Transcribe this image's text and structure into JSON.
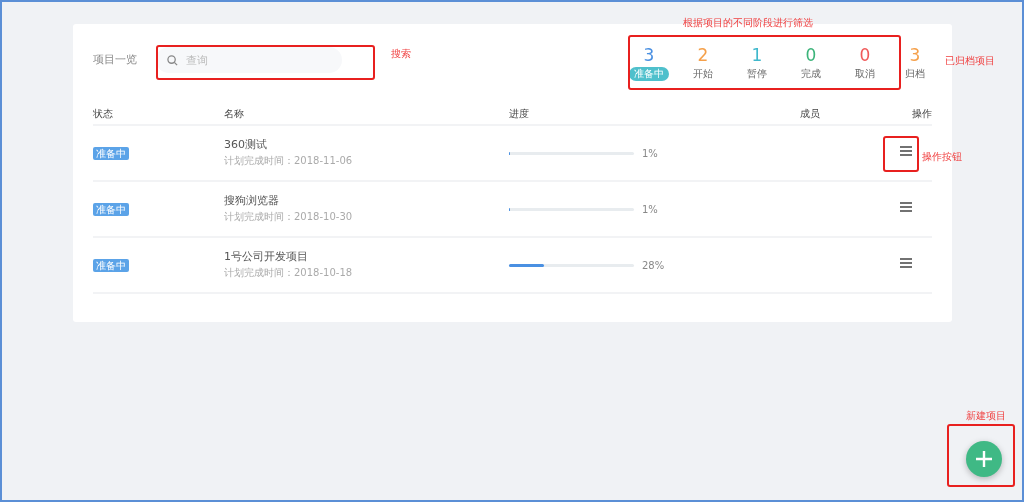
{
  "header": {
    "title": "项目一览",
    "search": {
      "placeholder": "查询"
    }
  },
  "filters": [
    {
      "count": "3",
      "label": "准备中",
      "color": "#4a90e2",
      "selected": true
    },
    {
      "count": "2",
      "label": "开始",
      "color": "#f5a04a",
      "selected": false
    },
    {
      "count": "1",
      "label": "暂停",
      "color": "#3fb8cc",
      "selected": false
    },
    {
      "count": "0",
      "label": "完成",
      "color": "#3cb47a",
      "selected": false
    },
    {
      "count": "0",
      "label": "取消",
      "color": "#f05a5a",
      "selected": false
    }
  ],
  "archived": {
    "count": "3",
    "label": "归档"
  },
  "table": {
    "columns": [
      "状态",
      "名称",
      "进度",
      "成员",
      "操作"
    ],
    "rows": [
      {
        "status": "准备中",
        "name": "360测试",
        "plan": "计划完成时间：2018-11-06",
        "level": 0.01,
        "percent": "1%"
      },
      {
        "status": "准备中",
        "name": "搜狗浏览器",
        "plan": "计划完成时间：2018-10-30",
        "level": 0.01,
        "percent": "1%"
      },
      {
        "status": "准备中",
        "name": "1号公司开发项目",
        "plan": "计划完成时间：2018-10-18",
        "level": 0.28,
        "percent": "28%"
      }
    ]
  },
  "annotations": [
    {
      "kind": "framed",
      "text": "搜索"
    },
    {
      "kind": "framed",
      "text": "根据项目的不同阶段进行筛选"
    },
    {
      "kind": "plain",
      "text": "已归档项目"
    },
    {
      "kind": "framed",
      "text": "操作按钮"
    },
    {
      "kind": "framed",
      "text": "新建项目"
    }
  ]
}
